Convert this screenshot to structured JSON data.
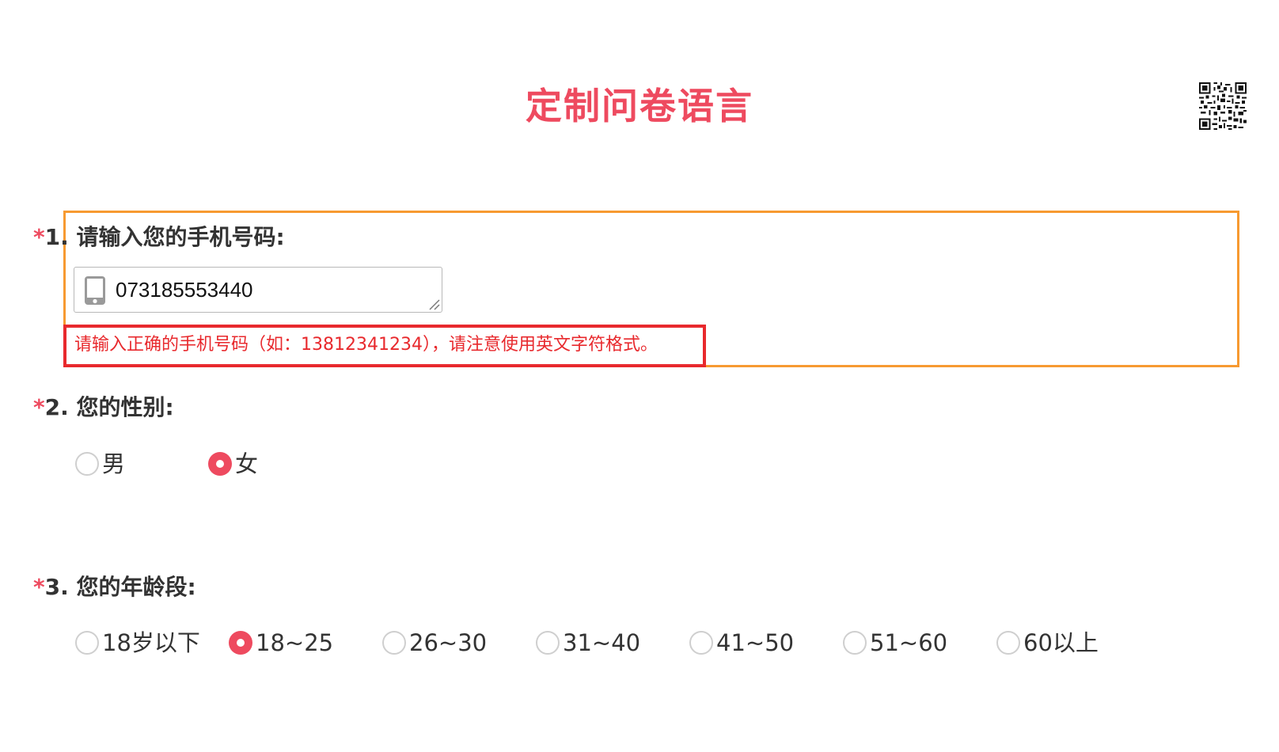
{
  "survey": {
    "title": "定制问卷语言",
    "accent_color": "#ee4a5f",
    "error_color": "#e8292d",
    "highlight_border_color": "#f79a31",
    "qr_icon": "qr-code-icon"
  },
  "questions": [
    {
      "required_mark": "*",
      "number": "1.",
      "text": "请输入您的手机号码:",
      "input_icon": "phone-icon",
      "input_value": "073185553440",
      "error": "请输入正确的手机号码（如：13812341234），请注意使用英文字符格式。"
    },
    {
      "required_mark": "*",
      "number": "2.",
      "text": "您的性别:",
      "options": [
        {
          "label": "男",
          "checked": false
        },
        {
          "label": "女",
          "checked": true
        }
      ]
    },
    {
      "required_mark": "*",
      "number": "3.",
      "text": "您的年龄段:",
      "options": [
        {
          "label": "18岁以下",
          "checked": false
        },
        {
          "label": "18~25",
          "checked": true
        },
        {
          "label": "26~30",
          "checked": false
        },
        {
          "label": "31~40",
          "checked": false
        },
        {
          "label": "41~50",
          "checked": false
        },
        {
          "label": "51~60",
          "checked": false
        },
        {
          "label": "60以上",
          "checked": false
        }
      ]
    }
  ]
}
